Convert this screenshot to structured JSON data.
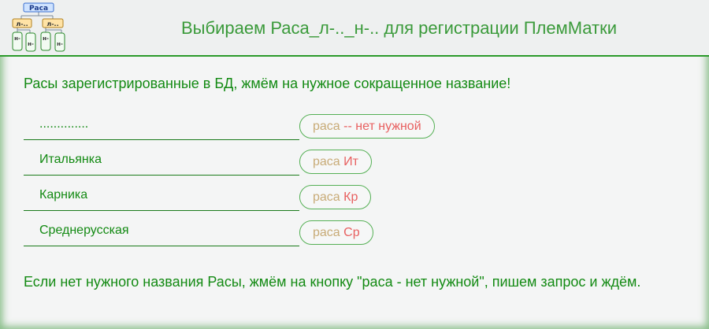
{
  "header": {
    "title": "Выбираем Раса_л-.._н-.. для регистрации ПлемМатки",
    "logo": {
      "root": "Раса",
      "branches": [
        "л-..",
        "л-.."
      ],
      "leaves": [
        "н-",
        "н-",
        "н-",
        "н-"
      ]
    }
  },
  "intro": "Расы зарегистрированные в БД, жмём на нужное сокращенное название!",
  "rows": [
    {
      "name": "..............",
      "btn_word": "раса",
      "btn_code": "-- нет нужной"
    },
    {
      "name": "Итальянка",
      "btn_word": "раса",
      "btn_code": "Ит"
    },
    {
      "name": "Карника",
      "btn_word": "раса",
      "btn_code": "Кр"
    },
    {
      "name": "Среднерусская",
      "btn_word": "раса",
      "btn_code": "Ср"
    }
  ],
  "footer": "Если нет нужного названия Расы, жмём на кнопку \"раса - нет нужной\", пишем запрос и ждём.",
  "colors": {
    "accent": "#138a13",
    "button_word": "#c8ab77",
    "button_code": "#e86060"
  }
}
